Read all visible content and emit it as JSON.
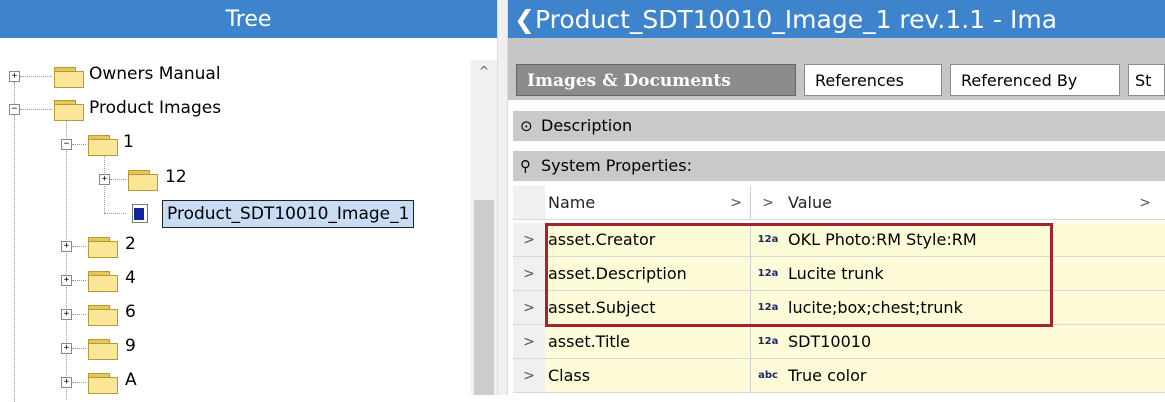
{
  "tree": {
    "header": "Tree",
    "items": [
      {
        "label": "Owners Manual",
        "expander": "+"
      },
      {
        "label": "Product Images",
        "expander": "−"
      },
      {
        "label": "1",
        "expander": "−"
      },
      {
        "label": "12",
        "expander": "+"
      },
      {
        "label": "Product_SDT10010_Image_1",
        "selected": true
      },
      {
        "label": "2",
        "expander": "+"
      },
      {
        "label": "4",
        "expander": "+"
      },
      {
        "label": "6",
        "expander": "+"
      },
      {
        "label": "9",
        "expander": "+"
      },
      {
        "label": "A",
        "expander": "+"
      }
    ]
  },
  "detail": {
    "title": "❮Product_SDT10010_Image_1 rev.1.1 - Ima",
    "tabs": [
      "Images & Documents",
      "References",
      "Referenced By",
      "St"
    ],
    "description_label": "Description",
    "system_properties_label": "System Properties:",
    "grid": {
      "header": {
        "name": "Name",
        "name_chevron": ">",
        "type_chevron": ">",
        "value": "Value",
        "value_chevron": ">"
      },
      "rows": [
        {
          "name": "asset.Creator",
          "type": "12a",
          "value": "OKL Photo:RM Style:RM"
        },
        {
          "name": "asset.Description",
          "type": "12a",
          "value": "Lucite trunk"
        },
        {
          "name": "asset.Subject",
          "type": "12a",
          "value": "lucite;box;chest;trunk"
        },
        {
          "name": "asset.Title",
          "type": "12a",
          "value": "SDT10010"
        },
        {
          "name": "Class",
          "type": "abc",
          "value": "True color"
        }
      ]
    }
  },
  "colors": {
    "titlebar": "#3d84cd",
    "highlight": "#a5232e",
    "property_bg": "#fefbd8"
  }
}
